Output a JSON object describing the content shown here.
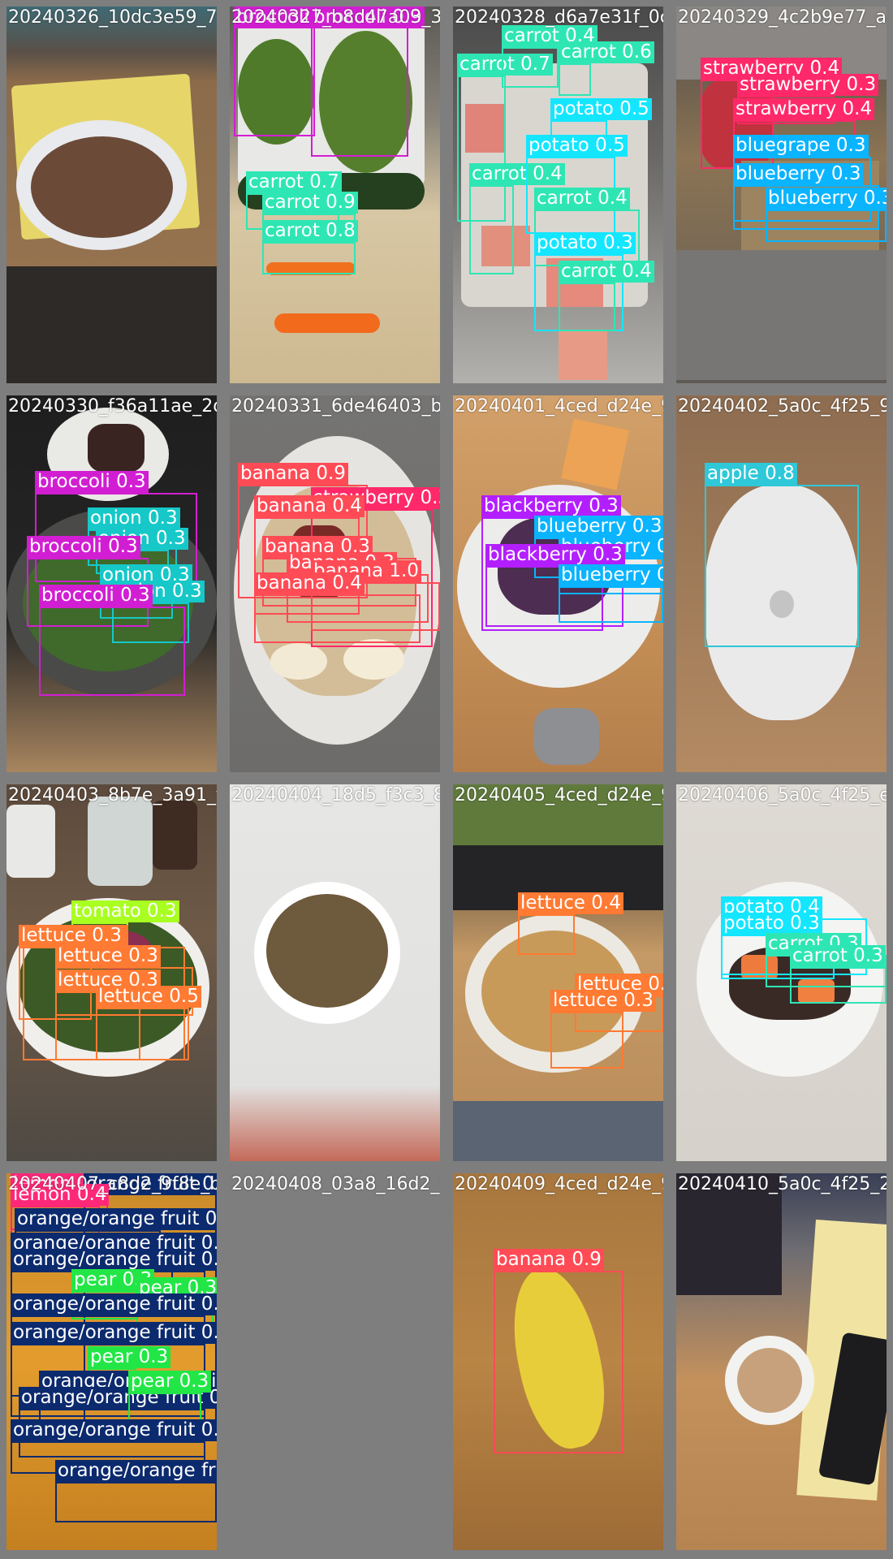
{
  "colors": {
    "broccoli": "#d21ed2",
    "carrot": "#2ee6b4",
    "potato": "#14e6ff",
    "strawberry": "#ff2868",
    "blueberry": "#0ab4ff",
    "blackberry": "#b31eff",
    "banana": "#ff4b55",
    "onion": "#16c8c8",
    "apple": "#2ec8d8",
    "lettuce": "#ff7a32",
    "tomato": "#a8ff20",
    "lemon": "#ff2878",
    "orange_fruit": "#0c2a6e",
    "pear": "#22e646"
  },
  "tiles": [
    {
      "title": "20240326_10dc3e59_77404974_f358d0d7",
      "scene": "chocolate-mousse-bowl",
      "detections": []
    },
    {
      "title": "20240327_b8d47a03_3ff5a1e2_c9b7a402",
      "scene": "broccoli-carrots-board",
      "detections": [
        {
          "label": "broccoli 0.9",
          "cls": "broccoli"
        },
        {
          "label": "broccoli 0.9",
          "cls": "broccoli"
        },
        {
          "label": "carrot 0.7",
          "cls": "carrot"
        },
        {
          "label": "carrot 0.9",
          "cls": "carrot"
        },
        {
          "label": "carrot 0.8",
          "cls": "carrot"
        }
      ]
    },
    {
      "title": "20240328_d6a7e31f_0c8b62e4_16d7c3ff",
      "scene": "diced-papaya-board",
      "detections": [
        {
          "label": "carrot 0.7",
          "cls": "carrot"
        },
        {
          "label": "carrot 0.4",
          "cls": "carrot"
        },
        {
          "label": "carrot 0.6",
          "cls": "carrot"
        },
        {
          "label": "potato 0.5",
          "cls": "potato"
        },
        {
          "label": "carrot 0.4",
          "cls": "carrot"
        },
        {
          "label": "potato 0.5",
          "cls": "potato"
        },
        {
          "label": "carrot 0.4",
          "cls": "carrot"
        },
        {
          "label": "potato 0.3",
          "cls": "potato"
        },
        {
          "label": "carrot 0.4",
          "cls": "carrot"
        }
      ]
    },
    {
      "title": "20240329_4c2b9e77_a31d8c40_94c0ff6d",
      "scene": "strawberry-blueberry-box",
      "detections": [
        {
          "label": "strawberry 0.4",
          "cls": "strawberry"
        },
        {
          "label": "strawberry 0.3",
          "cls": "strawberry"
        },
        {
          "label": "strawberry 0.4",
          "cls": "strawberry"
        },
        {
          "label": "bluegrape 0.3",
          "cls": "blueberry"
        },
        {
          "label": "blueberry 0.3",
          "cls": "blueberry"
        },
        {
          "label": "blueberry 0.3",
          "cls": "blueberry"
        }
      ]
    },
    {
      "title": "20240330_f36a11ae_2d4b03bf_3f72b0d9",
      "scene": "broccoli-pan",
      "detections": [
        {
          "label": "broccoli 0.3",
          "cls": "broccoli"
        },
        {
          "label": "onion 0.3",
          "cls": "onion"
        },
        {
          "label": "onion 0.3",
          "cls": "onion"
        },
        {
          "label": "broccoli 0.3",
          "cls": "broccoli"
        },
        {
          "label": "onion 0.3",
          "cls": "onion"
        },
        {
          "label": "onion 0.3",
          "cls": "onion"
        },
        {
          "label": "broccoli 0.3",
          "cls": "broccoli"
        }
      ]
    },
    {
      "title": "20240331_6de46403_b3f778bd_0275e21c",
      "scene": "banana-oatmeal-bowl",
      "detections": [
        {
          "label": "banana 0.9",
          "cls": "banana"
        },
        {
          "label": "strawberry 0.3",
          "cls": "strawberry"
        },
        {
          "label": "banana 0.4",
          "cls": "banana"
        },
        {
          "label": "banana 0.3",
          "cls": "banana"
        },
        {
          "label": "banana 0.3",
          "cls": "banana"
        },
        {
          "label": "banana 1.0",
          "cls": "banana"
        },
        {
          "label": "banana 0.4",
          "cls": "banana"
        }
      ]
    },
    {
      "title": "20240401_4ced_d24e_9c1a82f5",
      "scene": "berry-plate",
      "detections": [
        {
          "label": "blackberry 0.3",
          "cls": "blackberry"
        },
        {
          "label": "blueberry 0.3",
          "cls": "blueberry"
        },
        {
          "label": "blueberry 0.3",
          "cls": "blueberry"
        },
        {
          "label": "blackberry 0.3",
          "cls": "blackberry"
        },
        {
          "label": "blueberry 0.3",
          "cls": "blueberry"
        }
      ]
    },
    {
      "title": "20240402_5a0c_4f25_9e5a19d2",
      "scene": "apple-magic-mouse",
      "detections": [
        {
          "label": "apple 0.8",
          "cls": "apple"
        }
      ]
    },
    {
      "title": "20240403_8b7e_3a91_f2c0d6e8",
      "scene": "salad-bowl",
      "detections": [
        {
          "label": "tomato 0.3",
          "cls": "tomato"
        },
        {
          "label": "lettuce 0.3",
          "cls": "lettuce"
        },
        {
          "label": "lettuce 0.3",
          "cls": "lettuce"
        },
        {
          "label": "lettuce 0.3",
          "cls": "lettuce"
        },
        {
          "label": "lettuce 0.3",
          "cls": "lettuce"
        },
        {
          "label": "lettuce 0.5",
          "cls": "lettuce"
        }
      ]
    },
    {
      "title": "20240404_18d5_f3c3_8b1e47a0",
      "scene": "soup-bowl",
      "detections": []
    },
    {
      "title": "20240405_4ced_d24e_9c1a8f3b",
      "scene": "laptop-salad",
      "detections": [
        {
          "label": "lettuce 0.4",
          "cls": "lettuce"
        },
        {
          "label": "lettuce 0.3",
          "cls": "lettuce"
        },
        {
          "label": "lettuce 0.3",
          "cls": "lettuce"
        }
      ]
    },
    {
      "title": "20240406_5a0c_4f25_e3a28d0f",
      "scene": "potato-carrot-bowl",
      "detections": [
        {
          "label": "potato 0.4",
          "cls": "potato"
        },
        {
          "label": "potato 0.3",
          "cls": "potato"
        },
        {
          "label": "carrot 0.3",
          "cls": "carrot"
        },
        {
          "label": "carrot 0.3",
          "cls": "carrot"
        }
      ]
    },
    {
      "title": "20240407_c8d2_9f8e_b5a0e4c1",
      "scene": "orange-pile",
      "detections": [
        {
          "label": "lemon 0.3",
          "cls": "lemon"
        },
        {
          "label": "orange fruit 0.4",
          "cls": "orange_fruit"
        },
        {
          "label": "lemon 0.4",
          "cls": "lemon"
        },
        {
          "label": "orange/orange fruit 0.6",
          "cls": "orange_fruit"
        },
        {
          "label": "orange/orange fruit 0.4",
          "cls": "orange_fruit"
        },
        {
          "label": "orange/orange fruit 0.3",
          "cls": "orange_fruit"
        },
        {
          "label": "pear 0.3",
          "cls": "pear"
        },
        {
          "label": "pear 0.3",
          "cls": "pear"
        },
        {
          "label": "orange/orange fruit 0.3",
          "cls": "orange_fruit"
        },
        {
          "label": "orange/orange fruit 0.3",
          "cls": "orange_fruit"
        },
        {
          "label": "pear 0.3",
          "cls": "pear"
        },
        {
          "label": "orange/orange fruit 0.3",
          "cls": "orange_fruit"
        },
        {
          "label": "orange/orange fruit 0.3",
          "cls": "orange_fruit"
        },
        {
          "label": "pear 0.3",
          "cls": "pear"
        },
        {
          "label": "orange/orange fruit 0.3",
          "cls": "orange_fruit"
        },
        {
          "label": "orange/orange fruit 0.3",
          "cls": "orange_fruit"
        }
      ]
    },
    {
      "title": "20240408_03a8_16d2_f7c9e1b4",
      "scene": "empty",
      "detections": []
    },
    {
      "title": "20240409_4ced_d24e_9c1a8e77",
      "scene": "banana-wood",
      "detections": [
        {
          "label": "banana 0.9",
          "cls": "banana"
        }
      ]
    },
    {
      "title": "20240410_5a0c_4f25_29a8d19c",
      "scene": "coffee-cup-desk",
      "detections": []
    }
  ]
}
